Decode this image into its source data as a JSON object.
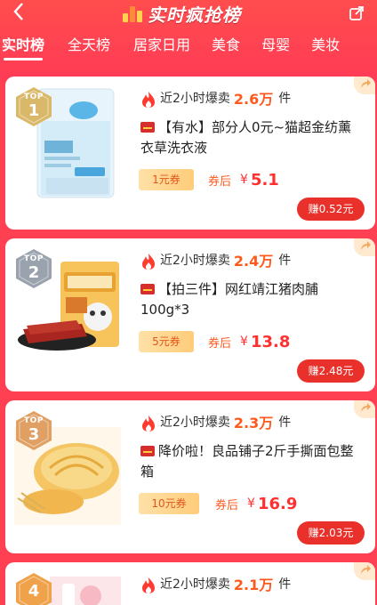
{
  "header": {
    "back_icon": "chevron-left-icon",
    "title": "实时疯抢榜",
    "chart_icon": "bar-chart-icon",
    "share_icon": "share-icon"
  },
  "tabs": [
    {
      "label": "实时榜",
      "active": true
    },
    {
      "label": "全天榜",
      "active": false
    },
    {
      "label": "居家日用",
      "active": false
    },
    {
      "label": "美食",
      "active": false
    },
    {
      "label": "母婴",
      "active": false
    },
    {
      "label": "美妆",
      "active": false
    }
  ],
  "products": [
    {
      "rank_top": "TOP",
      "rank": "1",
      "badge_color": "#d9b86a",
      "hot_label": "近2小时爆卖",
      "hot_value": "2.6万",
      "hot_unit": "件",
      "tag": "【有水】",
      "title": "部分人0元~猫超金纺薰衣草洗衣液",
      "coupon": "1元券",
      "after_label": "券后",
      "currency": "¥",
      "price": "5.1",
      "earn": "赚0.52元"
    },
    {
      "rank_top": "TOP",
      "rank": "2",
      "badge_color": "#9aa3ad",
      "hot_label": "近2小时爆卖",
      "hot_value": "2.4万",
      "hot_unit": "件",
      "tag": "【拍三件】",
      "title": "网红靖江猪肉脯100g*3",
      "coupon": "5元券",
      "after_label": "券后",
      "currency": "¥",
      "price": "13.8",
      "earn": "赚2.48元"
    },
    {
      "rank_top": "TOP",
      "rank": "3",
      "badge_color": "#e0a064",
      "hot_label": "近2小时爆卖",
      "hot_value": "2.3万",
      "hot_unit": "件",
      "tag": "降价啦！",
      "title": "良品铺子2斤手撕面包整箱",
      "coupon": "10元券",
      "after_label": "券后",
      "currency": "¥",
      "price": "16.9",
      "earn": "赚2.03元"
    },
    {
      "rank_top": "",
      "rank": "4",
      "badge_color": "#f0a24a",
      "hot_label": "近2小时爆卖",
      "hot_value": "2.1万",
      "hot_unit": "件",
      "tag": "",
      "title": "",
      "coupon": "",
      "after_label": "",
      "currency": "",
      "price": "",
      "earn": ""
    }
  ]
}
